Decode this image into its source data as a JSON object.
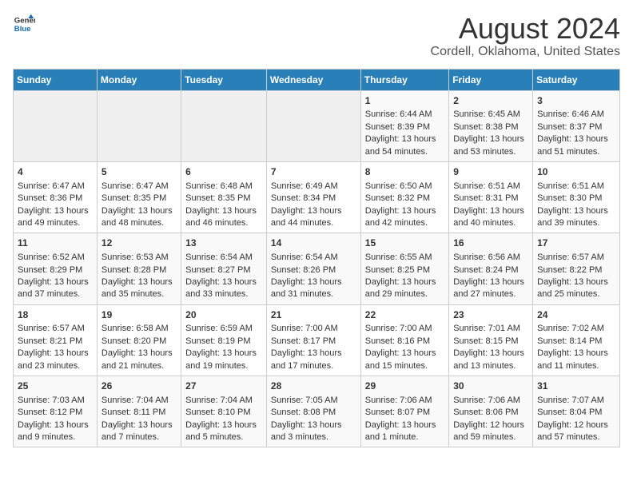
{
  "header": {
    "logo_line1": "General",
    "logo_line2": "Blue",
    "title": "August 2024",
    "subtitle": "Cordell, Oklahoma, United States"
  },
  "calendar": {
    "days_of_week": [
      "Sunday",
      "Monday",
      "Tuesday",
      "Wednesday",
      "Thursday",
      "Friday",
      "Saturday"
    ],
    "weeks": [
      [
        {
          "day": "",
          "empty": true
        },
        {
          "day": "",
          "empty": true
        },
        {
          "day": "",
          "empty": true
        },
        {
          "day": "",
          "empty": true
        },
        {
          "day": "1",
          "sunrise": "6:44 AM",
          "sunset": "8:39 PM",
          "daylight": "13 hours and 54 minutes."
        },
        {
          "day": "2",
          "sunrise": "6:45 AM",
          "sunset": "8:38 PM",
          "daylight": "13 hours and 53 minutes."
        },
        {
          "day": "3",
          "sunrise": "6:46 AM",
          "sunset": "8:37 PM",
          "daylight": "13 hours and 51 minutes."
        }
      ],
      [
        {
          "day": "4",
          "sunrise": "6:47 AM",
          "sunset": "8:36 PM",
          "daylight": "13 hours and 49 minutes."
        },
        {
          "day": "5",
          "sunrise": "6:47 AM",
          "sunset": "8:35 PM",
          "daylight": "13 hours and 48 minutes."
        },
        {
          "day": "6",
          "sunrise": "6:48 AM",
          "sunset": "8:35 PM",
          "daylight": "13 hours and 46 minutes."
        },
        {
          "day": "7",
          "sunrise": "6:49 AM",
          "sunset": "8:34 PM",
          "daylight": "13 hours and 44 minutes."
        },
        {
          "day": "8",
          "sunrise": "6:50 AM",
          "sunset": "8:32 PM",
          "daylight": "13 hours and 42 minutes."
        },
        {
          "day": "9",
          "sunrise": "6:51 AM",
          "sunset": "8:31 PM",
          "daylight": "13 hours and 40 minutes."
        },
        {
          "day": "10",
          "sunrise": "6:51 AM",
          "sunset": "8:30 PM",
          "daylight": "13 hours and 39 minutes."
        }
      ],
      [
        {
          "day": "11",
          "sunrise": "6:52 AM",
          "sunset": "8:29 PM",
          "daylight": "13 hours and 37 minutes."
        },
        {
          "day": "12",
          "sunrise": "6:53 AM",
          "sunset": "8:28 PM",
          "daylight": "13 hours and 35 minutes."
        },
        {
          "day": "13",
          "sunrise": "6:54 AM",
          "sunset": "8:27 PM",
          "daylight": "13 hours and 33 minutes."
        },
        {
          "day": "14",
          "sunrise": "6:54 AM",
          "sunset": "8:26 PM",
          "daylight": "13 hours and 31 minutes."
        },
        {
          "day": "15",
          "sunrise": "6:55 AM",
          "sunset": "8:25 PM",
          "daylight": "13 hours and 29 minutes."
        },
        {
          "day": "16",
          "sunrise": "6:56 AM",
          "sunset": "8:24 PM",
          "daylight": "13 hours and 27 minutes."
        },
        {
          "day": "17",
          "sunrise": "6:57 AM",
          "sunset": "8:22 PM",
          "daylight": "13 hours and 25 minutes."
        }
      ],
      [
        {
          "day": "18",
          "sunrise": "6:57 AM",
          "sunset": "8:21 PM",
          "daylight": "13 hours and 23 minutes."
        },
        {
          "day": "19",
          "sunrise": "6:58 AM",
          "sunset": "8:20 PM",
          "daylight": "13 hours and 21 minutes."
        },
        {
          "day": "20",
          "sunrise": "6:59 AM",
          "sunset": "8:19 PM",
          "daylight": "13 hours and 19 minutes."
        },
        {
          "day": "21",
          "sunrise": "7:00 AM",
          "sunset": "8:17 PM",
          "daylight": "13 hours and 17 minutes."
        },
        {
          "day": "22",
          "sunrise": "7:00 AM",
          "sunset": "8:16 PM",
          "daylight": "13 hours and 15 minutes."
        },
        {
          "day": "23",
          "sunrise": "7:01 AM",
          "sunset": "8:15 PM",
          "daylight": "13 hours and 13 minutes."
        },
        {
          "day": "24",
          "sunrise": "7:02 AM",
          "sunset": "8:14 PM",
          "daylight": "13 hours and 11 minutes."
        }
      ],
      [
        {
          "day": "25",
          "sunrise": "7:03 AM",
          "sunset": "8:12 PM",
          "daylight": "13 hours and 9 minutes."
        },
        {
          "day": "26",
          "sunrise": "7:04 AM",
          "sunset": "8:11 PM",
          "daylight": "13 hours and 7 minutes."
        },
        {
          "day": "27",
          "sunrise": "7:04 AM",
          "sunset": "8:10 PM",
          "daylight": "13 hours and 5 minutes."
        },
        {
          "day": "28",
          "sunrise": "7:05 AM",
          "sunset": "8:08 PM",
          "daylight": "13 hours and 3 minutes."
        },
        {
          "day": "29",
          "sunrise": "7:06 AM",
          "sunset": "8:07 PM",
          "daylight": "13 hours and 1 minute."
        },
        {
          "day": "30",
          "sunrise": "7:06 AM",
          "sunset": "8:06 PM",
          "daylight": "12 hours and 59 minutes."
        },
        {
          "day": "31",
          "sunrise": "7:07 AM",
          "sunset": "8:04 PM",
          "daylight": "12 hours and 57 minutes."
        }
      ]
    ]
  }
}
